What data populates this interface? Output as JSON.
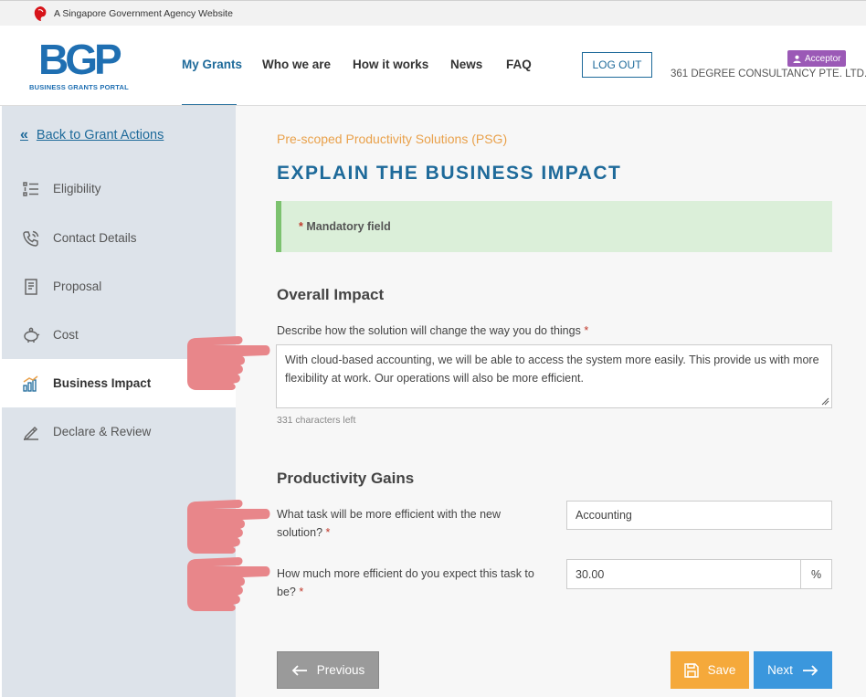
{
  "gov_banner": {
    "text": "A Singapore Government Agency Website"
  },
  "brand": {
    "logo_text": "BGP",
    "logo_subtitle": "BUSINESS GRANTS PORTAL"
  },
  "nav": {
    "items": [
      {
        "label": "My Grants",
        "active": true
      },
      {
        "label": "Who we are"
      },
      {
        "label": "How it works"
      },
      {
        "label": "News"
      },
      {
        "label": "FAQ"
      }
    ],
    "logout_label": "LOG OUT",
    "role_label": "Acceptor",
    "company_name": "361 DEGREE CONSULTANCY PTE. LTD."
  },
  "sidebar": {
    "back_label": "Back to Grant Actions",
    "items": [
      {
        "label": "Eligibility",
        "icon": "list-icon"
      },
      {
        "label": "Contact Details",
        "icon": "phone-icon"
      },
      {
        "label": "Proposal",
        "icon": "document-icon"
      },
      {
        "label": "Cost",
        "icon": "piggy-bank-icon"
      },
      {
        "label": "Business Impact",
        "icon": "bar-chart-icon",
        "active": true
      },
      {
        "label": "Declare & Review",
        "icon": "pen-icon"
      }
    ]
  },
  "main": {
    "scheme": "Pre-scoped Productivity Solutions (PSG)",
    "title": "EXPLAIN THE BUSINESS IMPACT",
    "mandatory_note": "Mandatory field",
    "overall_impact": {
      "heading": "Overall Impact",
      "label": "Describe how the solution will change the way you do things",
      "value": "With cloud-based accounting, we will be able to access the system more easily. This provide us with more flexibility at work. Our operations will also be more efficient.",
      "char_count": "331 characters left"
    },
    "productivity": {
      "heading": "Productivity Gains",
      "task_label": "What task will be more efficient with the new solution?",
      "task_value": "Accounting",
      "efficiency_label": "How much more efficient do you expect this task to be?",
      "efficiency_value": "30.00",
      "efficiency_unit": "%"
    },
    "buttons": {
      "previous": "Previous",
      "save": "Save",
      "next": "Next"
    }
  },
  "colors": {
    "primary": "#1e6a9a",
    "accent_orange": "#e9a14b",
    "save_button": "#f5a93b",
    "next_button": "#3b97dd",
    "previous_button": "#9a9a9a",
    "mandatory_bg": "#dbefd9",
    "hand_pointer": "#e8868a",
    "role_badge": "#9b59b6"
  }
}
